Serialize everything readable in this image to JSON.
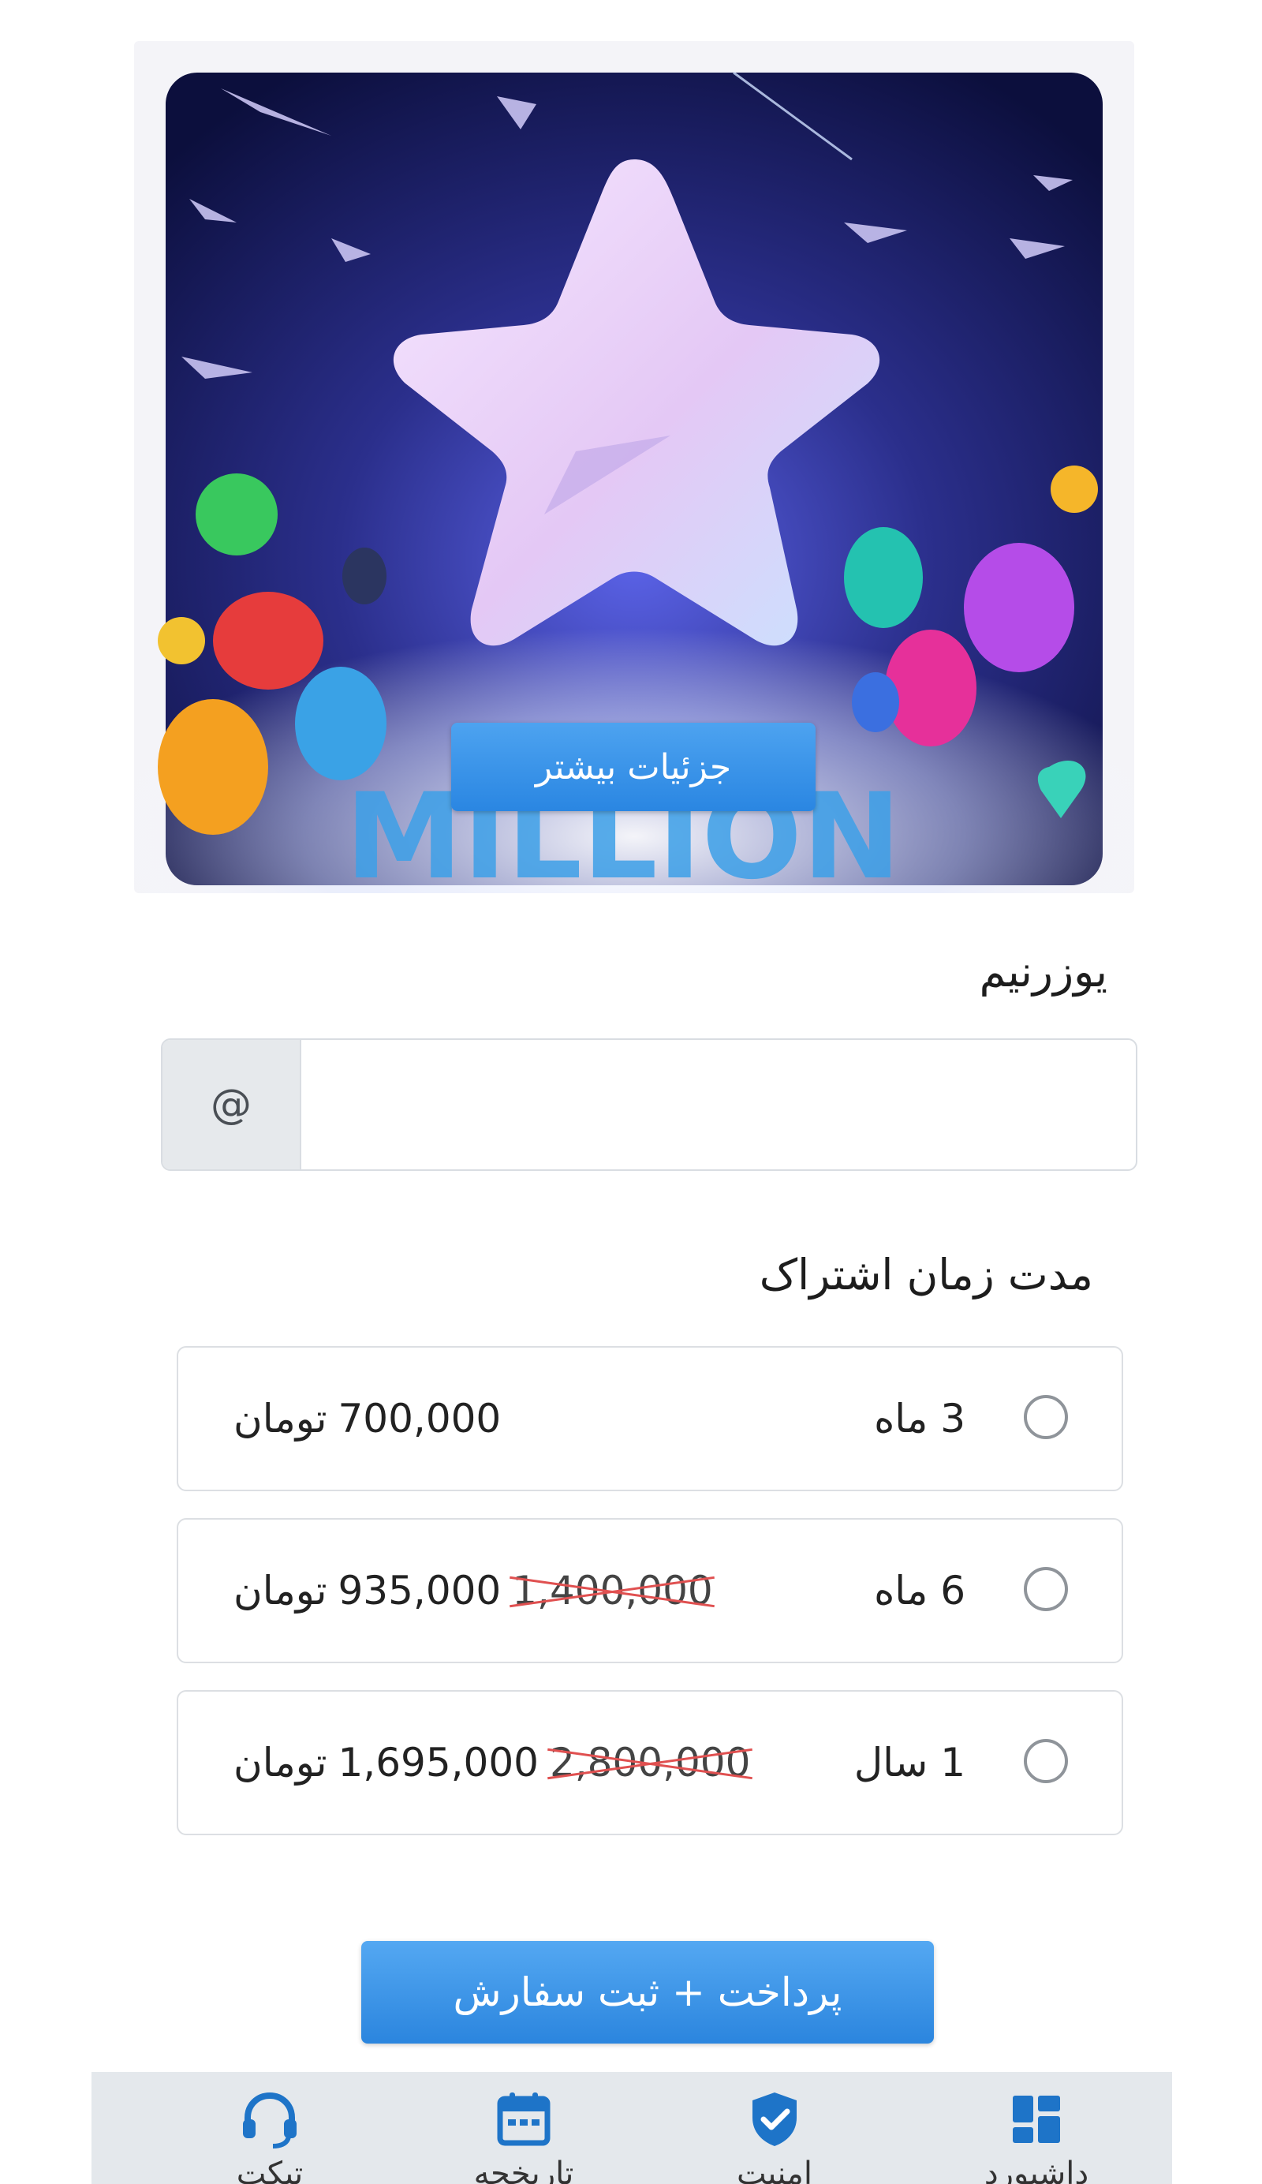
{
  "banner": {
    "more_details_label": "جزئیات بیشتر",
    "image_text": "MILLION"
  },
  "username": {
    "label": "یوزرنیم",
    "prefix": "@",
    "value": "",
    "placeholder": ""
  },
  "subscription": {
    "label": "مدت زمان اشتراک",
    "plans": [
      {
        "duration": "3 ماه",
        "old_price": "",
        "price": "700,000",
        "unit": "تومان",
        "selected": false
      },
      {
        "duration": "6 ماه",
        "old_price": "1,400,000",
        "price": "935,000",
        "unit": "تومان",
        "selected": false
      },
      {
        "duration": "1 سال",
        "old_price": "2,800,000",
        "price": "1,695,000",
        "unit": "تومان",
        "selected": false
      }
    ]
  },
  "submit": {
    "label": "پرداخت + ثبت سفارش"
  },
  "bottom_nav": {
    "items": [
      {
        "label": "داشبورد",
        "icon": "dashboard-icon",
        "color": "#1e74c8"
      },
      {
        "label": "امنیت",
        "icon": "shield-check-icon",
        "color": "#1e74c8"
      },
      {
        "label": "تاریخچه",
        "icon": "calendar-icon",
        "color": "#1e74c8"
      },
      {
        "label": "تیکت",
        "icon": "headset-icon",
        "color": "#1e74c8"
      }
    ]
  },
  "colors": {
    "primary_button": "#2a86e2",
    "strike": "#e05050",
    "nav_background": "#e4e8ec"
  }
}
